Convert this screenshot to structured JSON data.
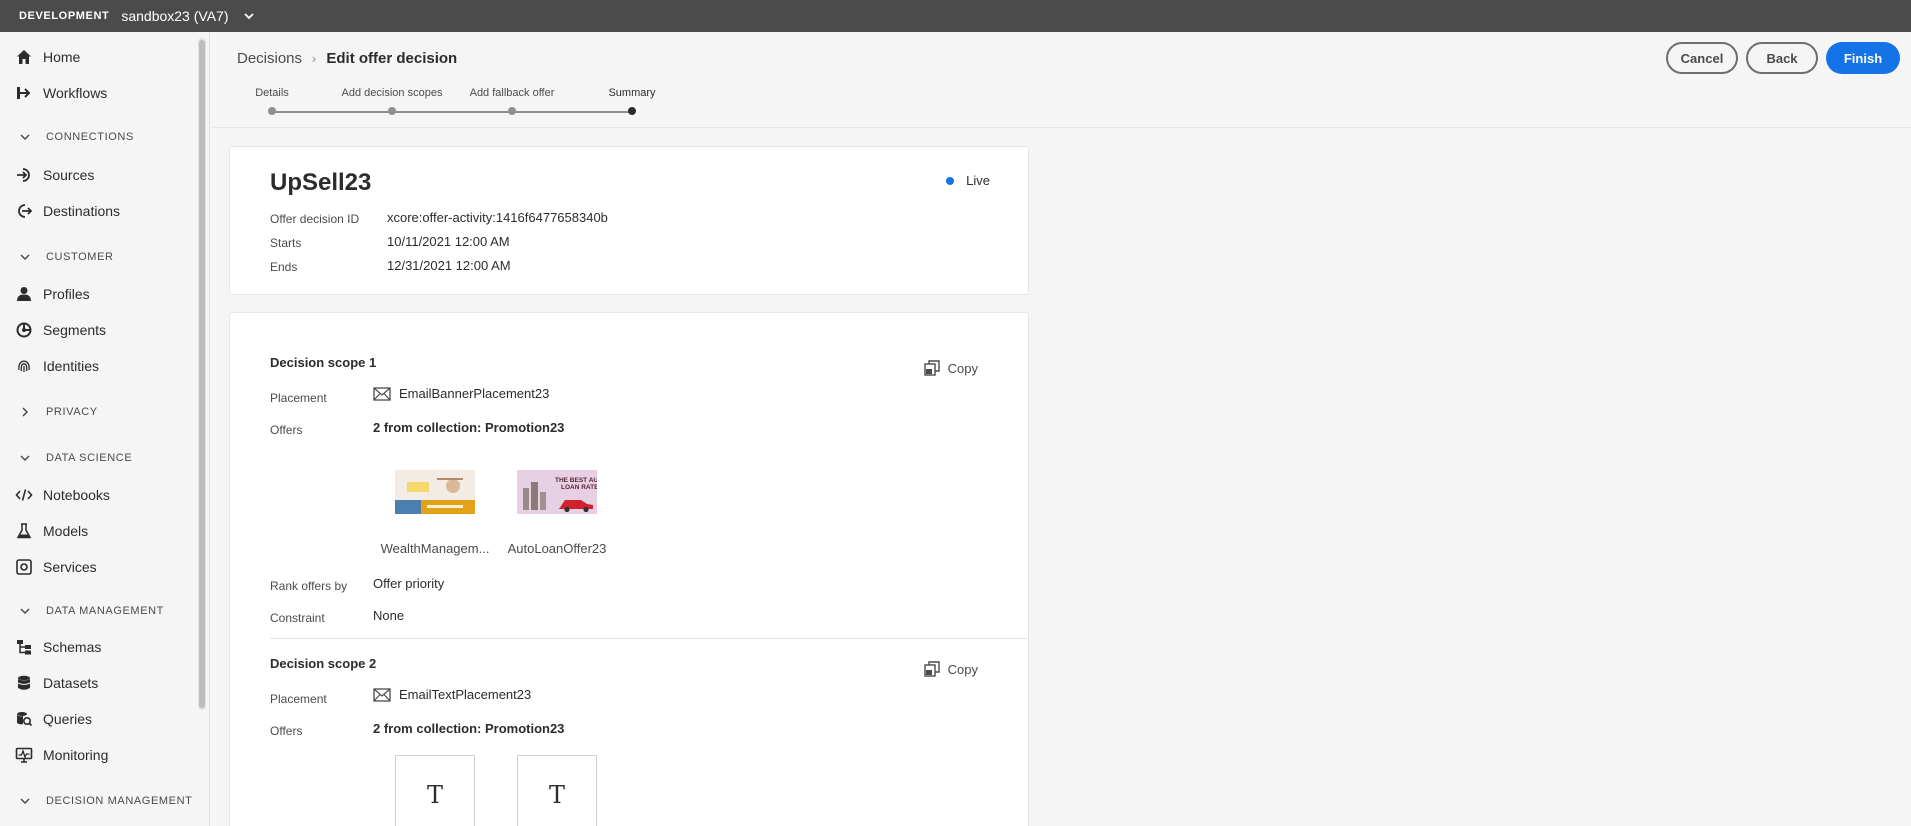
{
  "topbar": {
    "env_label": "DEVELOPMENT",
    "sandbox": "sandbox23 (VA7)"
  },
  "sidebar": {
    "items": [
      {
        "label": "Home",
        "icon": "home-icon"
      },
      {
        "label": "Workflows",
        "icon": "workflow-icon"
      },
      {
        "section": "CONNECTIONS"
      },
      {
        "label": "Sources",
        "icon": "sources-icon"
      },
      {
        "label": "Destinations",
        "icon": "destinations-icon"
      },
      {
        "section": "CUSTOMER"
      },
      {
        "label": "Profiles",
        "icon": "profile-icon"
      },
      {
        "label": "Segments",
        "icon": "segments-icon"
      },
      {
        "label": "Identities",
        "icon": "fingerprint-icon"
      },
      {
        "section": "PRIVACY"
      },
      {
        "section": "DATA SCIENCE"
      },
      {
        "label": "Notebooks",
        "icon": "code-icon"
      },
      {
        "label": "Models",
        "icon": "flask-icon"
      },
      {
        "label": "Services",
        "icon": "services-icon"
      },
      {
        "section": "DATA MANAGEMENT"
      },
      {
        "label": "Schemas",
        "icon": "schema-icon"
      },
      {
        "label": "Datasets",
        "icon": "database-icon"
      },
      {
        "label": "Queries",
        "icon": "query-icon"
      },
      {
        "label": "Monitoring",
        "icon": "monitor-icon"
      },
      {
        "section": "DECISION MANAGEMENT"
      }
    ]
  },
  "header": {
    "breadcrumb_parent": "Decisions",
    "breadcrumb_current": "Edit offer decision",
    "cancel_label": "Cancel",
    "back_label": "Back",
    "finish_label": "Finish",
    "accent_color": "#1473e6"
  },
  "stepper": {
    "steps": [
      "Details",
      "Add decision scopes",
      "Add fallback offer",
      "Summary"
    ],
    "active": "Summary"
  },
  "summary": {
    "name": "UpSell23",
    "status": "Live",
    "id_label": "Offer decision ID",
    "id_value": "xcore:offer-activity:1416f6477658340b",
    "starts_label": "Starts",
    "starts_value": "10/11/2021 12:00 AM",
    "ends_label": "Ends",
    "ends_value": "12/31/2021 12:00 AM"
  },
  "scopes": [
    {
      "title": "Decision scope 1",
      "copy_label": "Copy",
      "placement_label": "Placement",
      "placement": "EmailBannerPlacement23",
      "offers_label": "Offers",
      "offers": "2 from collection: Promotion23",
      "offer_items": [
        "WealthManagem...",
        "AutoLoanOffer23"
      ],
      "rank_label": "Rank offers by",
      "rank": "Offer priority",
      "constraint_label": "Constraint",
      "constraint": "None"
    },
    {
      "title": "Decision scope 2",
      "copy_label": "Copy",
      "placement_label": "Placement",
      "placement": "EmailTextPlacement23",
      "offers_label": "Offers",
      "offers": "2 from collection: Promotion23",
      "text_thumb_glyph": "T"
    }
  ]
}
